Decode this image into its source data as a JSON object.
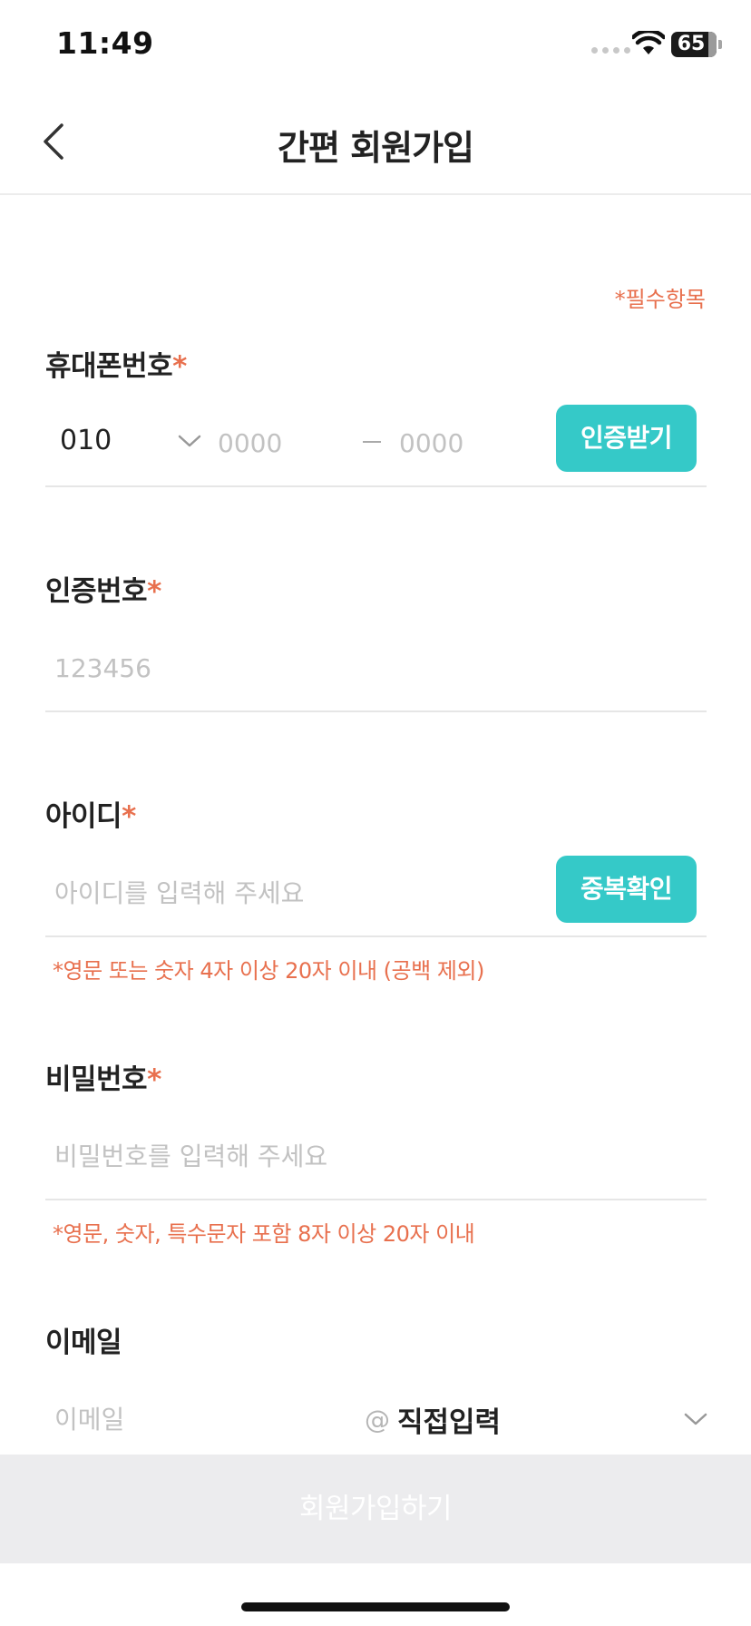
{
  "status_bar": {
    "time": "11:49",
    "battery": "65"
  },
  "header": {
    "title": "간편 회원가입"
  },
  "required_note": "*필수항목",
  "phone": {
    "label": "휴대폰번호",
    "asterisk": "*",
    "prefix_value": "010",
    "middle_placeholder": "0000",
    "last_placeholder": "0000",
    "button": "인증받기"
  },
  "verification": {
    "label": "인증번호",
    "asterisk": "*",
    "placeholder": "123456"
  },
  "user_id": {
    "label": "아이디",
    "asterisk": "*",
    "placeholder": "아이디를 입력해 주세요",
    "button": "중복확인",
    "hint": "*영문 또는 숫자 4자 이상 20자 이내 (공백 제외)"
  },
  "password": {
    "label": "비밀번호",
    "asterisk": "*",
    "placeholder": "비밀번호를 입력해 주세요",
    "hint": "*영문, 숫자, 특수문자 포함 8자 이상 20자 이내"
  },
  "email": {
    "label": "이메일",
    "placeholder": "이메일",
    "at": "@",
    "domain": "직접입력"
  },
  "submit": {
    "label": "회원가입하기"
  },
  "colors": {
    "accent": "#35c9c8",
    "required": "#e8704e",
    "disabled": "#ececee"
  }
}
